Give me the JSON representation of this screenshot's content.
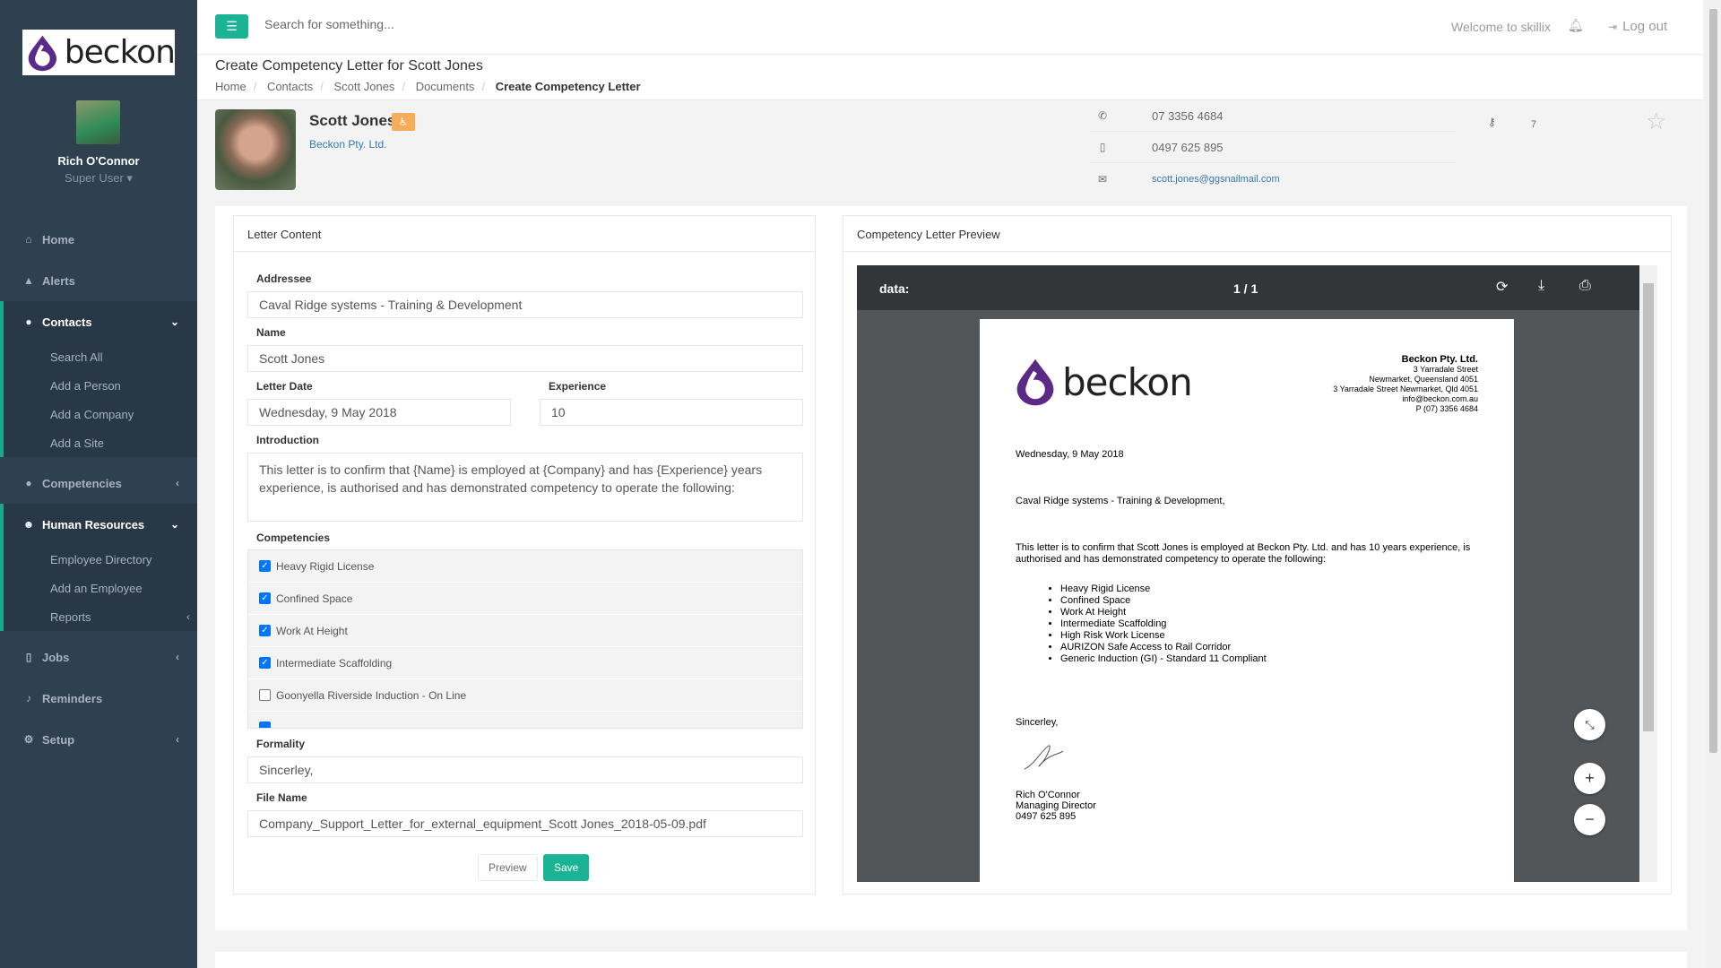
{
  "app": {
    "brand": "beckon"
  },
  "colors": {
    "sidebar": "#2f4050",
    "accent": "#1ab394",
    "badge": "#f8ac59",
    "link": "#337ab7"
  },
  "user": {
    "name": "Rich O'Connor",
    "role": "Super User ▾"
  },
  "nav": {
    "home": "Home",
    "alerts": "Alerts",
    "contacts": "Contacts",
    "contacts_sub": [
      "Search All",
      "Add a Person",
      "Add a Company",
      "Add a Site"
    ],
    "competencies": "Competencies",
    "hr": "Human Resources",
    "hr_sub": [
      "Employee Directory",
      "Add an Employee",
      "Reports"
    ],
    "jobs": "Jobs",
    "reminders": "Reminders",
    "setup": "Setup"
  },
  "topbar": {
    "search_placeholder": "Search for something...",
    "welcome": "Welcome to skillix",
    "logout": "Log out"
  },
  "heading": {
    "title": "Create Competency Letter for Scott Jones",
    "breadcrumb": [
      "Home",
      "Contacts",
      "Scott Jones",
      "Documents",
      "Create Competency Letter"
    ]
  },
  "contact": {
    "name": "Scott Jones",
    "company": "Beckon Pty. Ltd.",
    "phone": "07 3356 4684",
    "mobile": "0497 625 895",
    "email": "scott.jones@ggsnailmail.com",
    "key_value": "7"
  },
  "letter": {
    "panel_title": "Letter Content",
    "addressee_label": "Addressee",
    "addressee": "Caval Ridge systems - Training & Development",
    "name_label": "Name",
    "name": "Scott Jones",
    "date_label": "Letter Date",
    "date": "Wednesday, 9 May 2018",
    "experience_label": "Experience",
    "experience": "10",
    "intro_label": "Introduction",
    "intro": "This letter is to confirm that {Name} is employed at {Company} and has {Experience} years experience, is authorised and has demonstrated competency to operate the following:",
    "competencies_label": "Competencies",
    "competencies": [
      {
        "label": "Heavy Rigid License",
        "checked": true
      },
      {
        "label": "Confined Space",
        "checked": true
      },
      {
        "label": "Work At Height",
        "checked": true
      },
      {
        "label": "Intermediate Scaffolding",
        "checked": true
      },
      {
        "label": "Goonyella Riverside Induction - On Line",
        "checked": false
      }
    ],
    "formality_label": "Formality",
    "formality": "Sincerley,",
    "filename_label": "File Name",
    "filename": "Company_Support_Letter_for_external_equipment_Scott Jones_2018-05-09.pdf",
    "preview_btn": "Preview",
    "save_btn": "Save"
  },
  "preview": {
    "panel_title": "Competency Letter Preview",
    "doc_name": "data:",
    "page_indicator": "1  /  1",
    "company": "Beckon Pty. Ltd.",
    "addr1": "3 Yarradale Street",
    "addr2": "Newmarket, Queensland 4051",
    "addr3": "3 Yarradale Street Newmarket, Qld 4051",
    "addr4": "info@beckon.com.au",
    "addr5": "P (07) 3356 4684",
    "date": "Wednesday, 9 May 2018",
    "addressee": "Caval Ridge systems - Training & Development,",
    "body": "This letter is to confirm that Scott Jones is employed at Beckon Pty. Ltd. and has 10 years experience, is authorised and has demonstrated competency to operate the following:",
    "items": [
      "Heavy Rigid License",
      "Confined Space",
      "Work At Height",
      "Intermediate Scaffolding",
      "High Risk Work License",
      "AURIZON Safe Access to Rail Corridor",
      "Generic Induction (GI) - Standard 11 Compliant"
    ],
    "signoff": "Sincerley,",
    "signer": "Rich O'Connor",
    "signer_title": "Managing Director",
    "signer_phone": "0497 625 895"
  }
}
